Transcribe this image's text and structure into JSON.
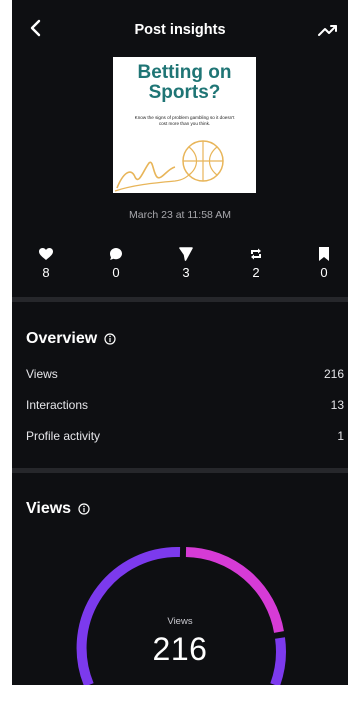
{
  "header": {
    "title": "Post insights",
    "back_icon": "back-chevron-icon",
    "trend_icon": "trend-icon"
  },
  "post": {
    "thumbnail_title": "Betting on Sports?",
    "thumbnail_subtitle": "Know the signs of problem gambling so it doesn't cost more than you think.",
    "date": "March 23 at 11:58 AM"
  },
  "stats": [
    {
      "icon": "heart-icon",
      "value": "8"
    },
    {
      "icon": "comment-icon",
      "value": "0"
    },
    {
      "icon": "send-icon",
      "value": "3"
    },
    {
      "icon": "repost-icon",
      "value": "2"
    },
    {
      "icon": "bookmark-icon",
      "value": "0"
    }
  ],
  "overview": {
    "title": "Overview",
    "rows": [
      {
        "label": "Views",
        "value": "216"
      },
      {
        "label": "Interactions",
        "value": "13"
      },
      {
        "label": "Profile activity",
        "value": "1"
      }
    ]
  },
  "views_section": {
    "title": "Views",
    "gauge_label": "Views",
    "gauge_value": "216",
    "colors": {
      "purple": "#7c3aed",
      "magenta": "#d63bd6"
    }
  },
  "colors": {
    "background": "#0e0f12",
    "divider": "#26272b",
    "thumbnail_title": "#1f7575",
    "art_gold": "#e8b559"
  }
}
